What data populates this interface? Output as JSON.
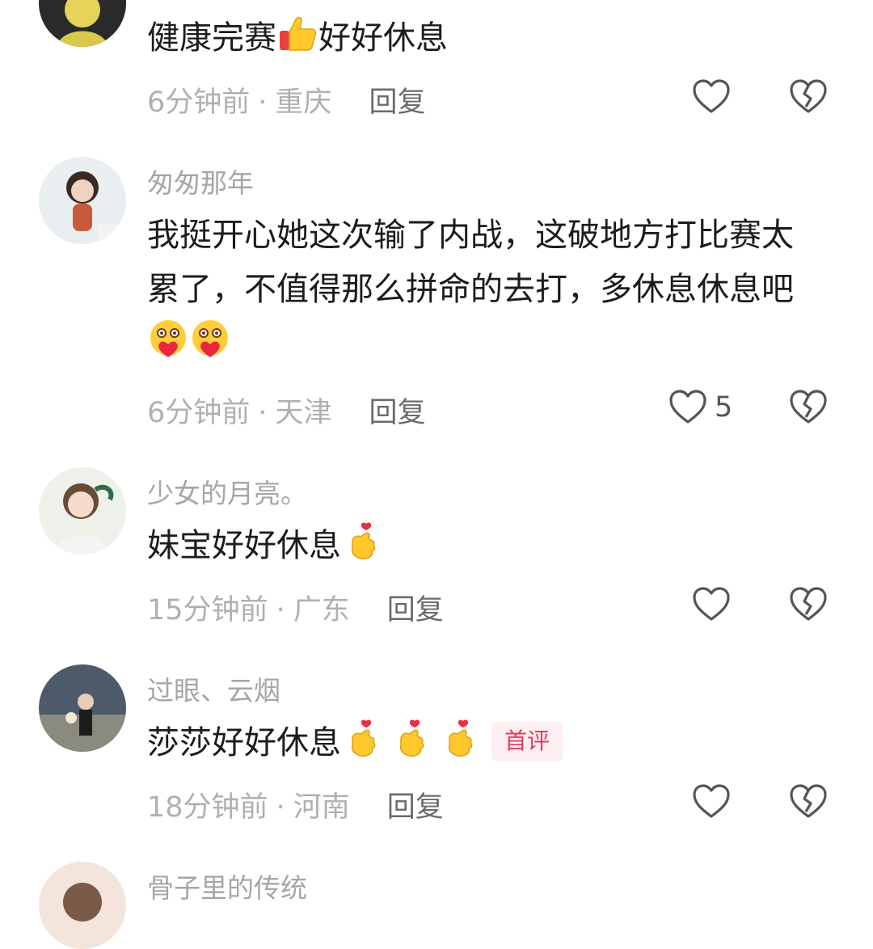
{
  "comments": [
    {
      "username": "",
      "text": "健康完赛",
      "text_after": "好好休息",
      "time": "6分钟前",
      "location": "重庆",
      "reply": "回复",
      "likes": ""
    },
    {
      "username": "匆匆那年",
      "text": "我挺开心她这次输了内战，这破地方打比赛太累了，不值得那么拼命的去打，多休息休息吧",
      "time": "6分钟前",
      "location": "天津",
      "reply": "回复",
      "likes": "5"
    },
    {
      "username": "少女的月亮。",
      "text": "妹宝好好休息",
      "time": "15分钟前",
      "location": "广东",
      "reply": "回复",
      "likes": ""
    },
    {
      "username": "过眼、云烟",
      "text": "莎莎好好休息",
      "badge": "首评",
      "time": "18分钟前",
      "location": "河南",
      "reply": "回复",
      "likes": ""
    },
    {
      "username": "骨子里的传统"
    }
  ],
  "meta_separator": "·",
  "icons": {
    "like": "heart-outline-icon",
    "dislike": "broken-heart-icon",
    "emoji_thumbs": "thumbs-up-emoji",
    "emoji_hearts": "smiling-face-with-heart-emoji",
    "emoji_finger_heart": "finger-heart-emoji"
  },
  "colors": {
    "text": "#1c1c1c",
    "muted": "#b0b0b0",
    "badge": "#e23b5d"
  }
}
